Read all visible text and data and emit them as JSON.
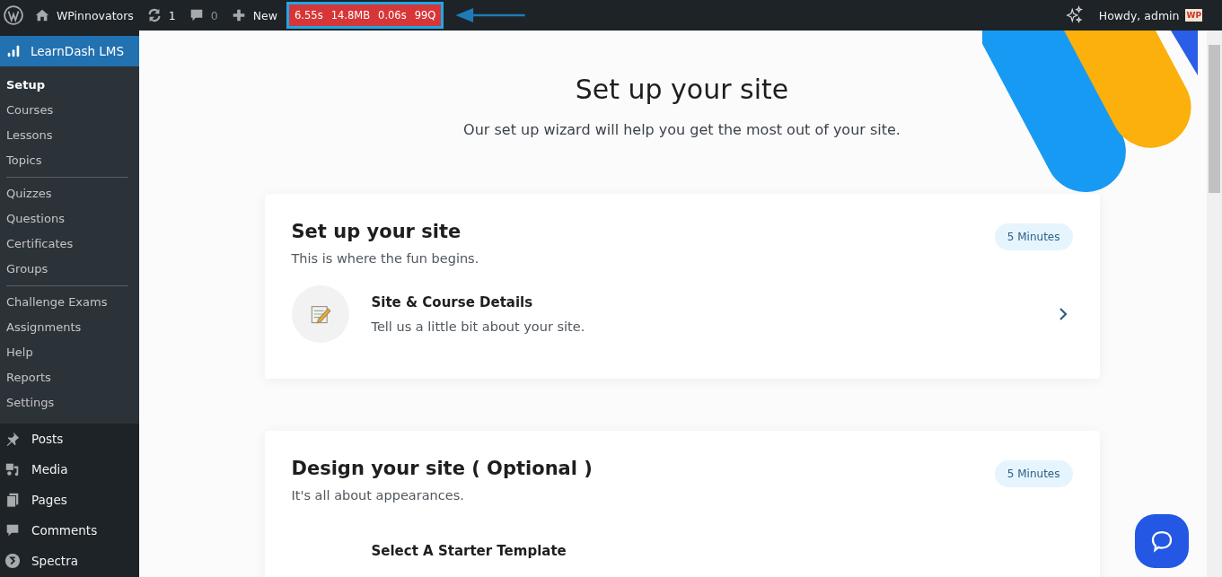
{
  "admin_bar": {
    "site_name": "WPinnovators",
    "updates": "1",
    "comments": "0",
    "new": "New",
    "stats": [
      "6.55s",
      "14.8MB",
      "0.06s",
      "99Q"
    ],
    "stats_highlighted": true,
    "greeting": "Howdy, admin",
    "avatar": "WP"
  },
  "sidebar": {
    "current_menu": "LearnDash LMS",
    "submenu_groups": [
      [
        {
          "label": "Setup",
          "selected": true
        },
        {
          "label": "Courses",
          "selected": false
        },
        {
          "label": "Lessons",
          "selected": false
        },
        {
          "label": "Topics",
          "selected": false
        }
      ],
      [
        {
          "label": "Quizzes",
          "selected": false
        },
        {
          "label": "Questions",
          "selected": false
        },
        {
          "label": "Certificates",
          "selected": false
        },
        {
          "label": "Groups",
          "selected": false
        }
      ],
      [
        {
          "label": "Challenge Exams",
          "selected": false
        },
        {
          "label": "Assignments",
          "selected": false
        },
        {
          "label": "Help",
          "selected": false
        },
        {
          "label": "Reports",
          "selected": false
        },
        {
          "label": "Settings",
          "selected": false
        }
      ]
    ],
    "menu": [
      "Posts",
      "Media",
      "Pages",
      "Comments",
      "Spectra"
    ]
  },
  "page": {
    "title": "Set up your site",
    "subtitle": "Our set up wizard will help you get the most out of your site.",
    "sections": [
      {
        "title": "Set up your site",
        "description": "This is where the fun begins.",
        "duration": "5 Minutes",
        "steps": [
          {
            "title": "Site & Course Details",
            "description": "Tell us a little bit about your site."
          }
        ]
      },
      {
        "title": "Design your site ( Optional )",
        "description": "It's all about appearances.",
        "duration": "5 Minutes",
        "steps": [
          {
            "title": "Select A Starter Template"
          }
        ]
      }
    ]
  }
}
